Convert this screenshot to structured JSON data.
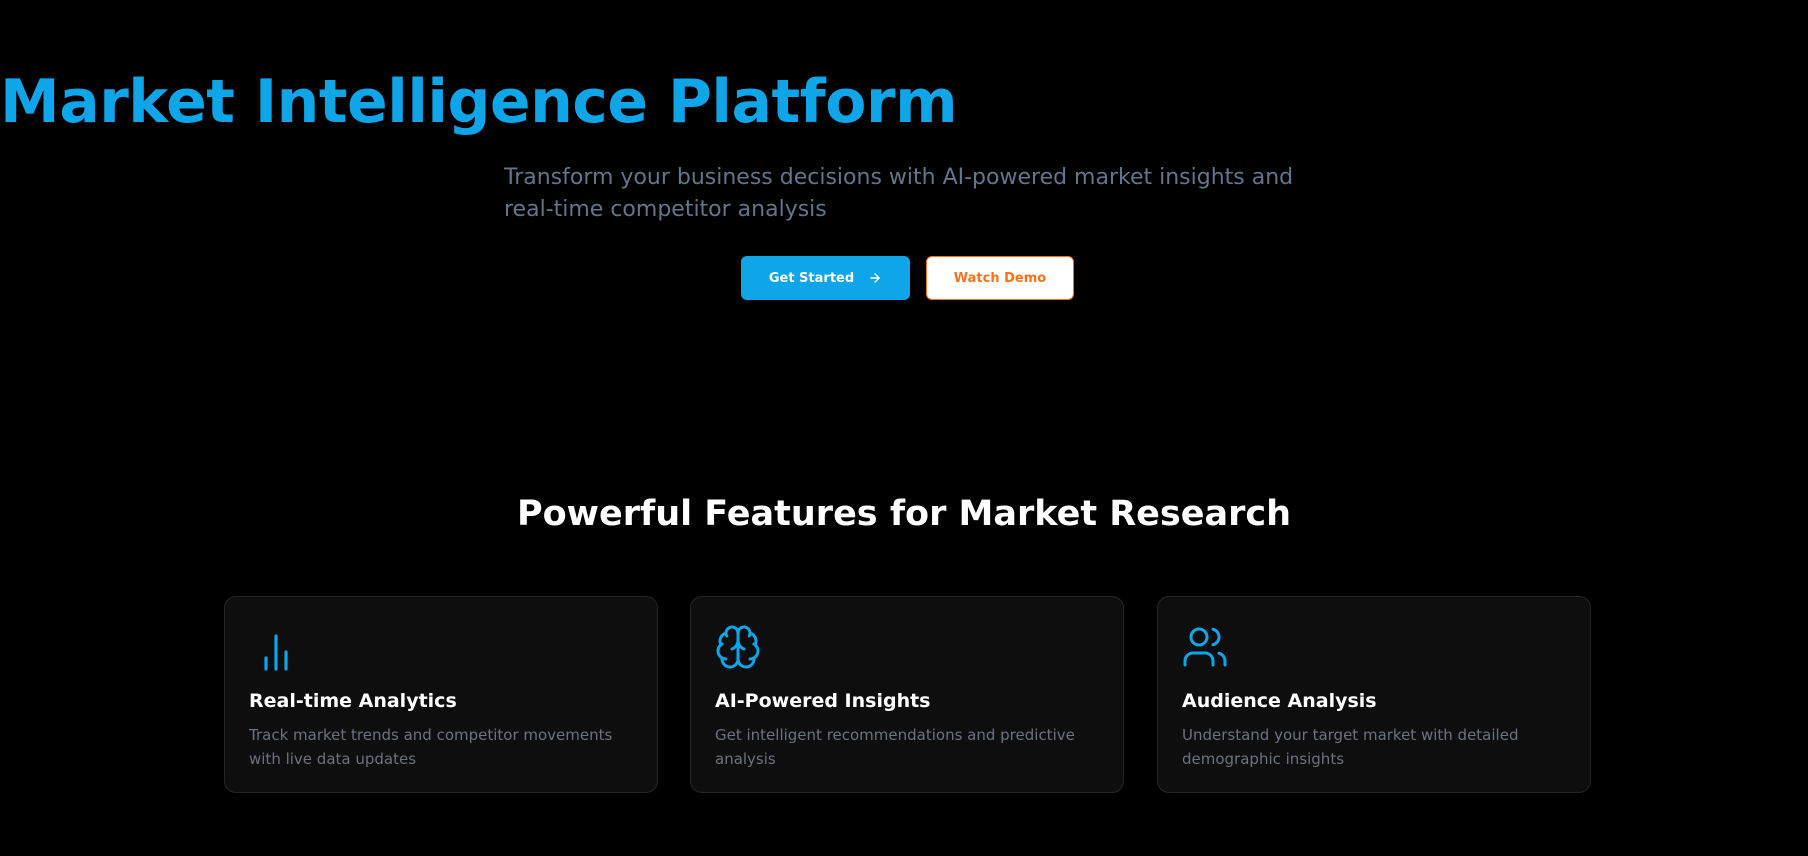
{
  "hero": {
    "title": "Market Intelligence Platform",
    "subtitle": "Transform your business decisions with AI-powered market insights and real-time competitor analysis",
    "primary_button_label": "Get Started",
    "primary_button_icon": "arrow-right-icon",
    "secondary_button_label": "Watch Demo"
  },
  "features": {
    "title": "Powerful Features for Market Research",
    "cards": [
      {
        "icon": "bar-chart-icon",
        "title": "Real-time Analytics",
        "description": "Track market trends and competitor movements with live data updates"
      },
      {
        "icon": "brain-icon",
        "title": "AI-Powered Insights",
        "description": "Get intelligent recommendations and predictive analysis"
      },
      {
        "icon": "users-icon",
        "title": "Audience Analysis",
        "description": "Understand your target market with detailed demographic insights"
      }
    ]
  },
  "colors": {
    "background": "#000000",
    "accent": "#0ea5e9",
    "secondary_accent": "#f97316",
    "muted_text": "#64748b",
    "card_background": "#0e0e0e"
  }
}
